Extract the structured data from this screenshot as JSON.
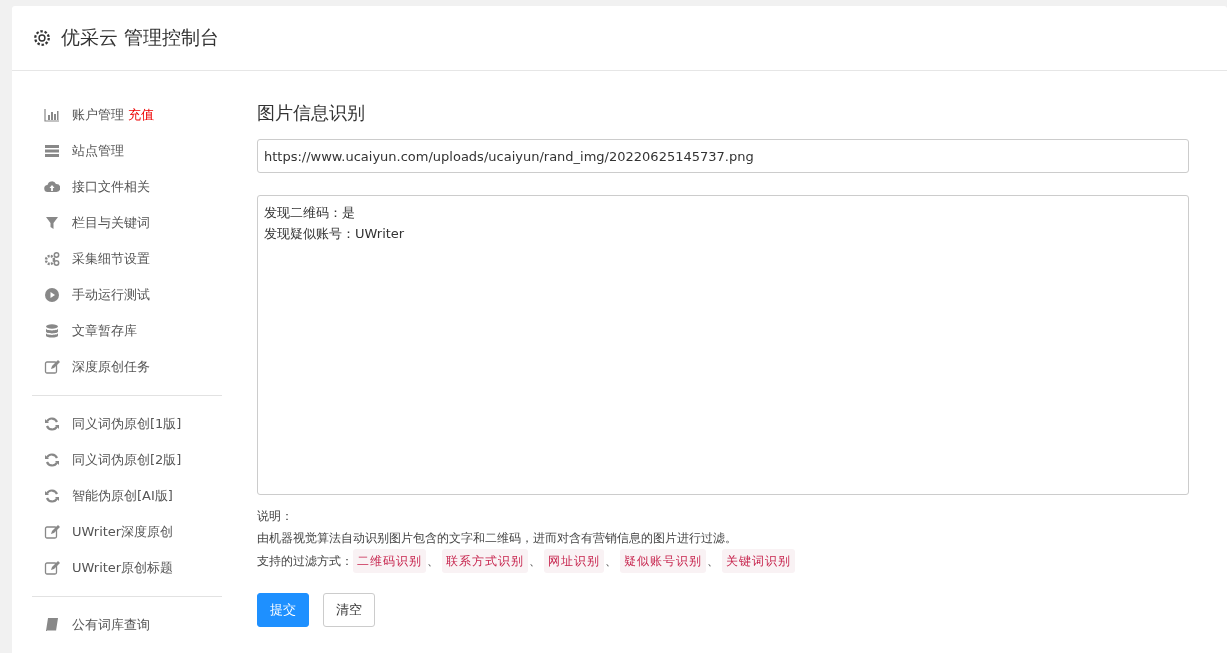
{
  "header": {
    "title": "优采云 管理控制台"
  },
  "sidebar": {
    "groups": [
      {
        "items": [
          {
            "label": "账户管理",
            "badge": "充值"
          },
          {
            "label": "站点管理"
          },
          {
            "label": "接口文件相关"
          },
          {
            "label": "栏目与关键词"
          },
          {
            "label": "采集细节设置"
          },
          {
            "label": "手动运行测试"
          },
          {
            "label": "文章暂存库"
          },
          {
            "label": "深度原创任务"
          }
        ]
      },
      {
        "items": [
          {
            "label": "同义词伪原创[1版]"
          },
          {
            "label": "同义词伪原创[2版]"
          },
          {
            "label": "智能伪原创[AI版]"
          },
          {
            "label": "UWriter深度原创"
          },
          {
            "label": "UWriter原创标题"
          }
        ]
      },
      {
        "items": [
          {
            "label": "公有词库查询"
          }
        ]
      }
    ]
  },
  "main": {
    "title": "图片信息识别",
    "url_field": {
      "value": "https://www.ucaiyun.com/uploads/ucaiyun/rand_img/20220625145737.png"
    },
    "result_box": {
      "lines": [
        "发现二维码：是",
        "发现疑似账号：UWriter"
      ]
    },
    "note_heading": "说明：",
    "note_text": "由机器视觉算法自动识别图片包含的文字和二维码，进而对含有营销信息的图片进行过滤。",
    "filter_label": "支持的过滤方式：",
    "filter_methods": [
      {
        "kind": "tag",
        "text": "二维码识别"
      },
      {
        "kind": "sep",
        "text": "、"
      },
      {
        "kind": "tag",
        "text": "联系方式识别"
      },
      {
        "kind": "sep",
        "text": "、"
      },
      {
        "kind": "tag",
        "text": "网址识别"
      },
      {
        "kind": "sep",
        "text": "、"
      },
      {
        "kind": "tag",
        "text": "疑似账号识别"
      },
      {
        "kind": "sep",
        "text": "、"
      },
      {
        "kind": "tag",
        "text": "关键词识别"
      }
    ],
    "buttons": [
      {
        "kind": "primary",
        "label": "提交"
      },
      {
        "kind": "default",
        "label": "清空"
      }
    ]
  }
}
